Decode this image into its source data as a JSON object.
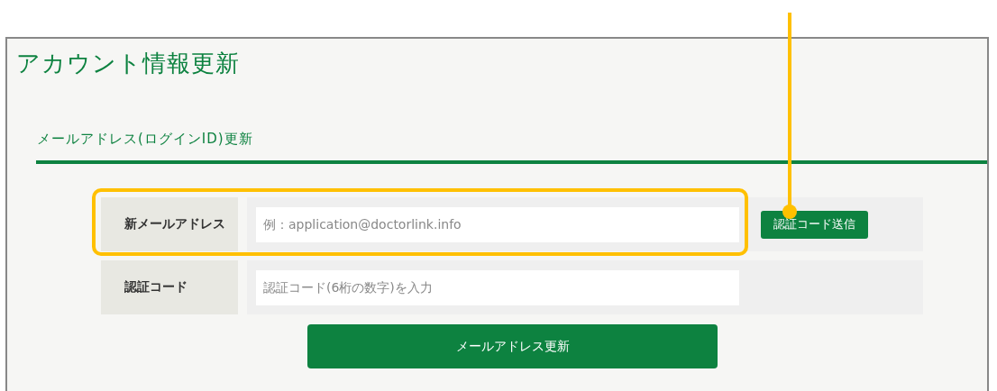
{
  "page_title": "アカウント情報更新",
  "section": {
    "title": "メールアドレス(ログインID)更新",
    "rows": [
      {
        "label": "新メールアドレス",
        "placeholder": "例：application@doctorlink.info",
        "button": "認証コード送信",
        "highlighted": true
      },
      {
        "label": "認証コード",
        "placeholder": "認証コード(6桁の数字)を入力",
        "highlighted": false
      }
    ],
    "submit": "メールアドレス更新"
  }
}
